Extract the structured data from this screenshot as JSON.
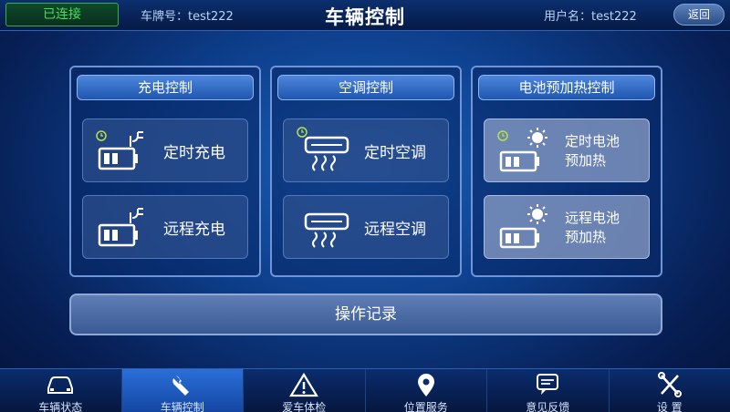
{
  "header": {
    "connection_status": "已连接",
    "plate": "车牌号：test222",
    "title": "车辆控制",
    "username": "用户名：test222",
    "back_label": "返回"
  },
  "panels": [
    {
      "title": "充电控制",
      "cards": [
        {
          "label": "定时充电",
          "icon": "charge-timer-icon"
        },
        {
          "label": "远程充电",
          "icon": "charge-remote-icon"
        }
      ]
    },
    {
      "title": "空调控制",
      "cards": [
        {
          "label": "定时空调",
          "icon": "ac-timer-icon"
        },
        {
          "label": "远程空调",
          "icon": "ac-remote-icon"
        }
      ]
    },
    {
      "title": "电池预加热控制",
      "cards": [
        {
          "label_line1": "定时电池",
          "label_line2": "预加热",
          "icon": "battery-heat-timer-icon"
        },
        {
          "label_line1": "远程电池",
          "label_line2": "预加热",
          "icon": "battery-heat-remote-icon"
        }
      ]
    }
  ],
  "record_label": "操作记录",
  "nav": [
    {
      "label": "车辆状态",
      "icon": "car-icon"
    },
    {
      "label": "车辆控制",
      "icon": "wrench-icon"
    },
    {
      "label": "爱车体检",
      "icon": "warning-icon"
    },
    {
      "label": "位置服务",
      "icon": "location-pin-icon"
    },
    {
      "label": "意见反馈",
      "icon": "feedback-icon"
    },
    {
      "label": "设 置",
      "icon": "settings-icon"
    }
  ],
  "colors": {
    "connected": "#46e05c",
    "active_nav": "#2a6fd8",
    "panel_border": "#6f95d6"
  }
}
